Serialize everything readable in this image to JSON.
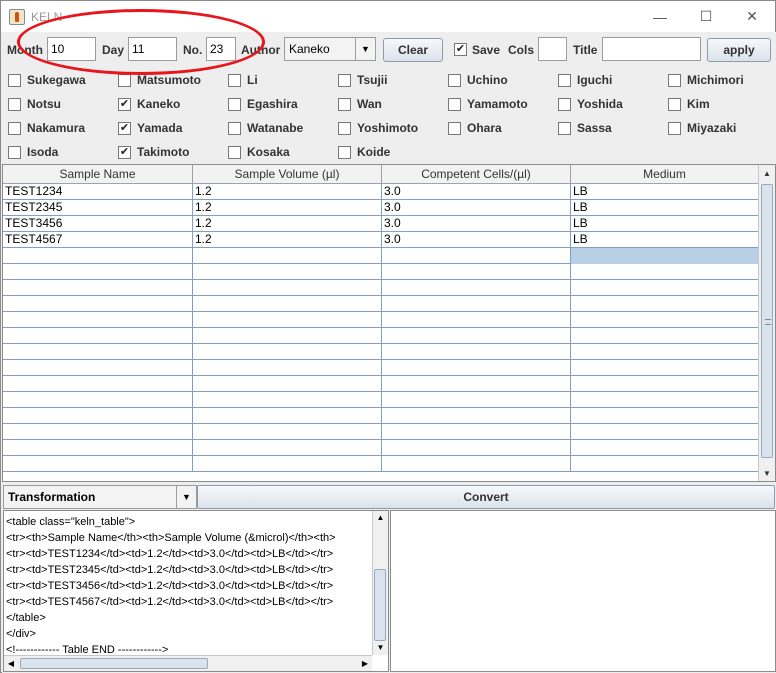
{
  "window": {
    "title": "KELN",
    "minimize_icon": "minimize-icon",
    "maximize_icon": "maximize-icon",
    "close_icon": "close-icon"
  },
  "toolbar": {
    "month_label": "Month",
    "month_value": "10",
    "day_label": "Day",
    "day_value": "11",
    "no_label": "No.",
    "no_value": "23",
    "author_label": "Author",
    "author_value": "Kaneko",
    "clear_label": "Clear",
    "save_label": "Save",
    "save_checked": true,
    "cols_label": "Cols",
    "cols_value": "",
    "title_label": "Title",
    "title_value": "",
    "apply_label": "apply"
  },
  "authors": [
    {
      "name": "Sukegawa",
      "checked": false
    },
    {
      "name": "Matsumoto",
      "checked": false
    },
    {
      "name": "Li",
      "checked": false
    },
    {
      "name": "Tsujii",
      "checked": false
    },
    {
      "name": "Uchino",
      "checked": false
    },
    {
      "name": "Iguchi",
      "checked": false
    },
    {
      "name": "Michimori",
      "checked": false
    },
    {
      "name": "Notsu",
      "checked": false
    },
    {
      "name": "Kaneko",
      "checked": true
    },
    {
      "name": "Egashira",
      "checked": false
    },
    {
      "name": "Wan",
      "checked": false
    },
    {
      "name": "Yamamoto",
      "checked": false
    },
    {
      "name": "Yoshida",
      "checked": false
    },
    {
      "name": "Kim",
      "checked": false
    },
    {
      "name": "Nakamura",
      "checked": false
    },
    {
      "name": "Yamada",
      "checked": true
    },
    {
      "name": "Watanabe",
      "checked": false
    },
    {
      "name": "Yoshimoto",
      "checked": false
    },
    {
      "name": "Ohara",
      "checked": false
    },
    {
      "name": "Sassa",
      "checked": false
    },
    {
      "name": "Miyazaki",
      "checked": false
    },
    {
      "name": "Isoda",
      "checked": false
    },
    {
      "name": "Takimoto",
      "checked": true
    },
    {
      "name": "Kosaka",
      "checked": false
    },
    {
      "name": "Koide",
      "checked": false
    }
  ],
  "table": {
    "columns": [
      "Sample Name",
      "Sample Volume (µl)",
      "Competent Cells/(µl)",
      "Medium"
    ],
    "rows": [
      [
        "TEST1234",
        "1.2",
        "3.0",
        "LB"
      ],
      [
        "TEST2345",
        "1.2",
        "3.0",
        "LB"
      ],
      [
        "TEST3456",
        "1.2",
        "3.0",
        "LB"
      ],
      [
        "TEST4567",
        "1.2",
        "3.0",
        "LB"
      ]
    ],
    "empty_rows": 14
  },
  "bottom": {
    "transformation_label": "Transformation",
    "convert_label": "Convert",
    "code_lines": [
      "<table class=\"keln_table\">",
      "<tr><th>Sample Name</th><th>Sample Volume (&microl)</th><th>",
      "<tr><td>TEST1234</td><td>1.2</td><td>3.0</td><td>LB</td></tr>",
      "<tr><td>TEST2345</td><td>1.2</td><td>3.0</td><td>LB</td></tr>",
      "<tr><td>TEST3456</td><td>1.2</td><td>3.0</td><td>LB</td></tr>",
      "<tr><td>TEST4567</td><td>1.2</td><td>3.0</td><td>LB</td></tr>",
      "</table>",
      "</div>",
      "<!------------ Table END ------------>"
    ]
  },
  "colors": {
    "annotation": "#e8151b",
    "selection": "#b8cfe5",
    "grid": "#7fa0c8"
  }
}
